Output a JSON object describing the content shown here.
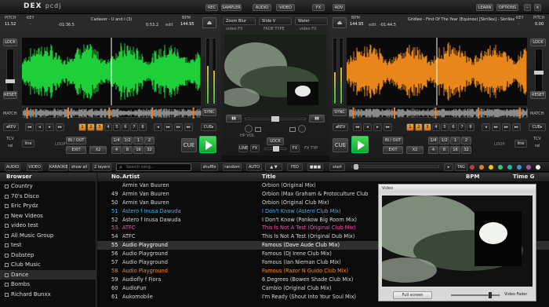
{
  "app": {
    "logo": "DEX",
    "logo_x": "pcdj"
  },
  "topbar": {
    "rec": "REC",
    "sampler": "SAMPLER",
    "audio": "AUDIO",
    "video": "VIDEO",
    "fx": "FX",
    "adv": "ADV",
    "learn": "LEARN",
    "options": "OPTIONS"
  },
  "deck_left": {
    "pitch_label": "PITCH",
    "key_label": "KEY",
    "bpm_label": "BPM",
    "pitch_value": "11.52",
    "key_value": "-",
    "time_elapsed": "-01:36.5",
    "time_remaining": "0:53.2",
    "title": "Cadaver - U and I (3)",
    "bpm": "144.95",
    "edit": "edit",
    "lock": "LOCK",
    "reset": "RESET",
    "match": "MATCH",
    "sync": "SYNC",
    "rev": "◂REV",
    "cue": "CUE▸",
    "tcv": "TCV",
    "rel": "rel",
    "line": "line",
    "loop": "LOOP",
    "in_out": "IN / OUT",
    "exit": "EXIT",
    "x2": "X2",
    "loop_sizes": [
      "1/4",
      "1/2",
      "1",
      "2",
      "4",
      "8",
      "16",
      "32"
    ],
    "cue_big": "CUE",
    "hot_cues": [
      "1",
      "2",
      "3",
      "4",
      "5",
      "6",
      "7",
      "8"
    ],
    "color": "#1fcf3a"
  },
  "deck_right": {
    "pitch_label": "PITCH",
    "key_label": "KEY",
    "bpm_label": "BPM",
    "pitch_value": "0.00",
    "key_value": "-",
    "time_elapsed": "-01:44.5",
    "time_remaining": "",
    "title": "Gridlee - First Of The Year (Equinox) [Skrillex] - Skrillex",
    "bpm": "144.95",
    "edit": "edit",
    "lock": "LOCK",
    "reset": "RESET",
    "match": "MATCH",
    "sync": "SYNC",
    "rev": "◂REV",
    "cue": "CUE▸",
    "tcv": "TCV",
    "rel": "rel",
    "line": "line",
    "loop": "LOOP",
    "in_out": "IN / OUT",
    "exit": "EXIT",
    "x2": "X2",
    "loop_sizes": [
      "1/4",
      "1/2",
      "1",
      "2",
      "4",
      "8",
      "16",
      "32"
    ],
    "cue_big": "CUE",
    "hot_cues": [
      "1",
      "2",
      "3",
      "4",
      "5",
      "6",
      "7",
      "8"
    ],
    "color": "#e8861c"
  },
  "mixer": {
    "fx_left": "Zoom Blur",
    "fx_mid": "Slide V",
    "fx_right": "Water",
    "video_fx": "video FX",
    "fade_type": "FADE TYPE",
    "video_fx2": "video FX",
    "hp": "HP VOL",
    "lock": "LOCK",
    "line": "LINE",
    "fx": "FX",
    "fx2": "FX",
    "fx_typ": "FX TYP"
  },
  "browser_bar": {
    "buttons": [
      "AUDIO",
      "VIDEO",
      "KARAOKE",
      "show all",
      "2 layers"
    ],
    "search_placeholder": "Search song...",
    "right_buttons": [
      "shuffle",
      "random",
      "AUTO",
      "▲ ▼",
      "FED",
      "■■■",
      "start"
    ],
    "tag": "TAG",
    "swatches": [
      "#c0392b",
      "#e67e22",
      "#f1c40f",
      "#2ecc71",
      "#1abc9c",
      "#3498db",
      "#9b59b6",
      "#ecf0f1"
    ]
  },
  "sidebar": {
    "header": "Browser",
    "items": [
      {
        "label": "Country"
      },
      {
        "label": "70's Disco"
      },
      {
        "label": "Eric Prydz"
      },
      {
        "label": "New Videos"
      },
      {
        "label": "video test"
      },
      {
        "label": "All Music Group"
      },
      {
        "label": "test"
      },
      {
        "label": "Dubstep"
      },
      {
        "label": "Club Music"
      },
      {
        "label": "Dance"
      },
      {
        "label": "Bombs"
      },
      {
        "label": "Richard Bunxx"
      }
    ]
  },
  "tracklist": {
    "columns": {
      "no": "No.",
      "artist": "Artist",
      "title": "Title",
      "bpm": "BPM",
      "time": "Time G"
    },
    "rows": [
      {
        "no": "",
        "artist": "Armin Van Buuren",
        "title": "Orbion (Original Mix)",
        "color": "#d8d8d8"
      },
      {
        "no": "49",
        "artist": "Armin Van Buuren",
        "title": "Orbion (Max Graham & Protoculture Club",
        "color": "#d8d8d8"
      },
      {
        "no": "50",
        "artist": "Armin Van Buuren",
        "title": "Orbion (Original Club Mix)",
        "color": "#d8d8d8"
      },
      {
        "no": "51",
        "artist": "Astero f Inusa Dawuda",
        "title": "I Don't Know (Astero Club Mix)",
        "color": "#3cb8ff"
      },
      {
        "no": "52",
        "artist": "Astero f Inusa Dawuda",
        "title": "I Don't Know (Pankow Big Room Mix)",
        "color": "#d8d8d8"
      },
      {
        "no": "53",
        "artist": "ATFC",
        "title": "This Is Not A Test (Original Club Mix)",
        "color": "#ff4fa8"
      },
      {
        "no": "54",
        "artist": "ATFC",
        "title": "This Is Not A Test (Original Dub Mix)",
        "color": "#d8d8d8"
      },
      {
        "no": "55",
        "artist": "Audio Playground",
        "title": "Famous (Dave Aude Club Mix)",
        "color": "#ffffff"
      },
      {
        "no": "56",
        "artist": "Audio Playground",
        "title": "Famous (DJ Irene Club Mix)",
        "color": "#d8d8d8"
      },
      {
        "no": "57",
        "artist": "Audio Playground",
        "title": "Famous (Ian Nieman Club Mix)",
        "color": "#d8d8d8"
      },
      {
        "no": "58",
        "artist": "Audio Playground",
        "title": "Famous (Razor N Guido Club Mix)",
        "color": "#ff8a1e"
      },
      {
        "no": "59",
        "artist": "Audiofly f Fiora",
        "title": "6 Degrees (Bowen Shade Club Mix)",
        "color": "#d8d8d8"
      },
      {
        "no": "60",
        "artist": "AudioFun",
        "title": "Cambio (Original Club Mix)",
        "color": "#d8d8d8"
      },
      {
        "no": "61",
        "artist": "Aukomobile",
        "title": "I'm Ready (Shout Into Your Soul Mix)",
        "color": "#d8d8d8"
      }
    ]
  },
  "video_window": {
    "title": "Video",
    "fullscreen": "Full screen",
    "slider_label": "Video Fader"
  }
}
